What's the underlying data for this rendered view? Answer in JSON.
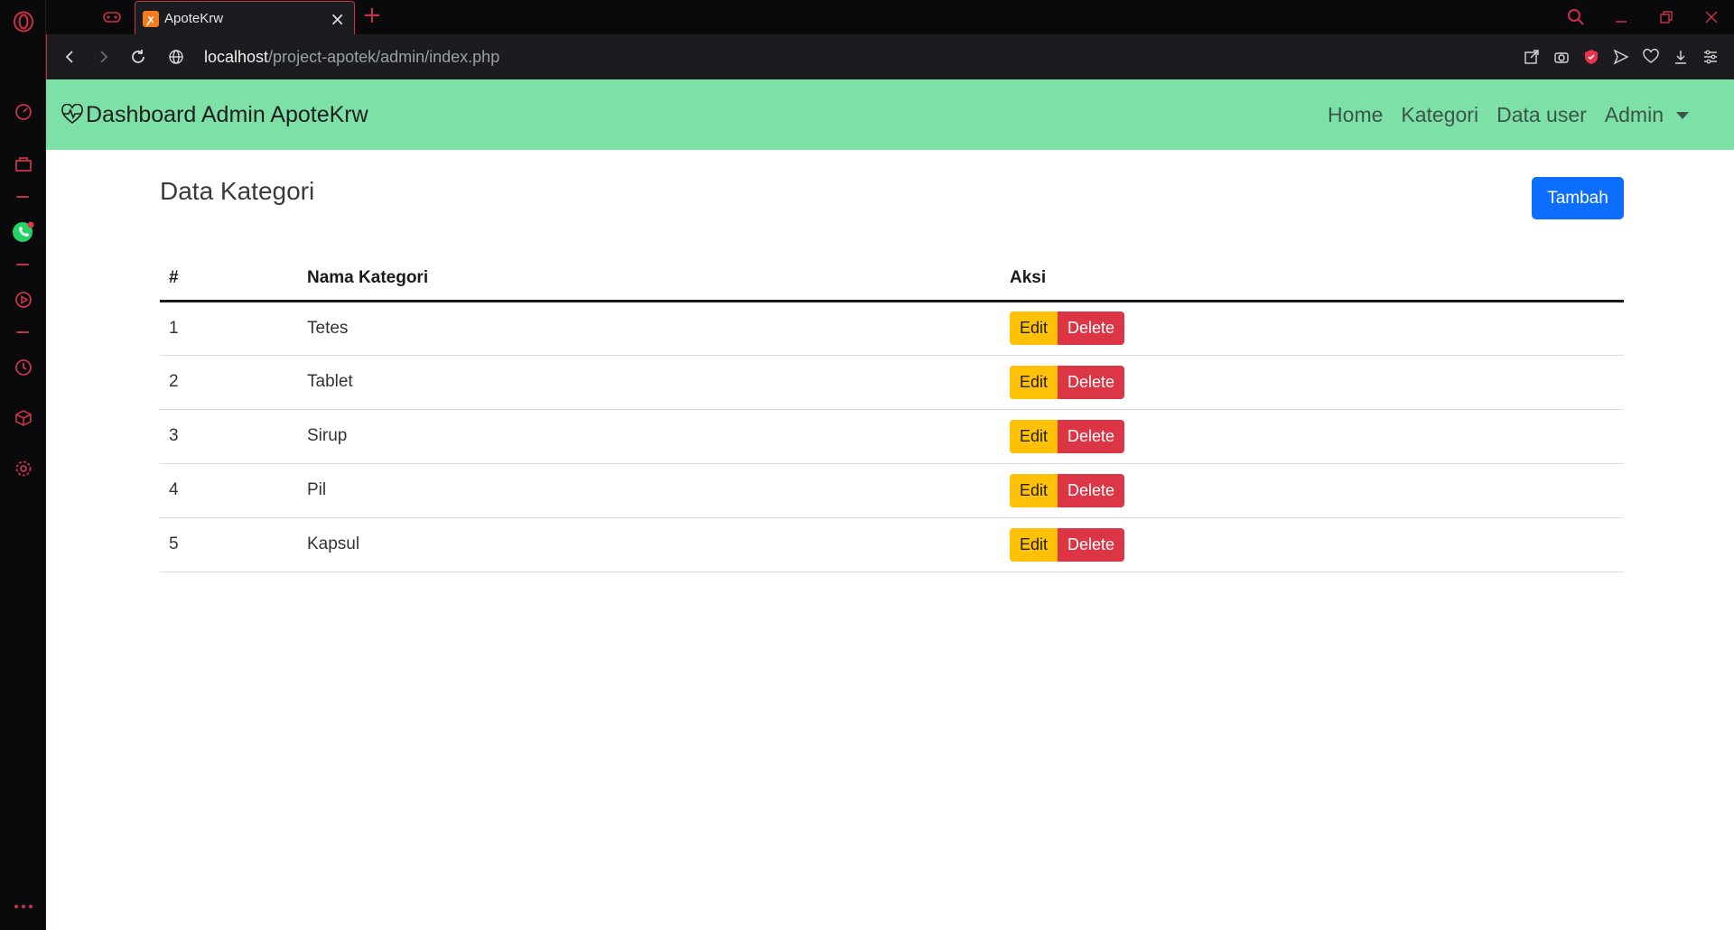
{
  "browser": {
    "tab_title": "ApoteKrw",
    "tab_favicon": "xampp-icon",
    "url_host": "localhost",
    "url_path": "/project-apotek/admin/index.php",
    "accent_color": "#c8324a"
  },
  "navbar": {
    "brand": "Dashboard Admin ApoteKrw",
    "brand_icon": "heart-pulse-icon",
    "background_color": "#7de0a7",
    "links": [
      {
        "label": "Home"
      },
      {
        "label": "Kategori"
      },
      {
        "label": "Data user"
      },
      {
        "label": "Admin"
      }
    ]
  },
  "page": {
    "title": "Data Kategori",
    "add_button": "Tambah",
    "table": {
      "headers": [
        "#",
        "Nama Kategori",
        "Aksi"
      ],
      "rows": [
        {
          "num": "1",
          "name": "Tetes"
        },
        {
          "num": "2",
          "name": "Tablet"
        },
        {
          "num": "3",
          "name": "Sirup"
        },
        {
          "num": "4",
          "name": "Pil"
        },
        {
          "num": "5",
          "name": "Kapsul"
        }
      ],
      "edit_label": "Edit",
      "delete_label": "Delete"
    }
  }
}
